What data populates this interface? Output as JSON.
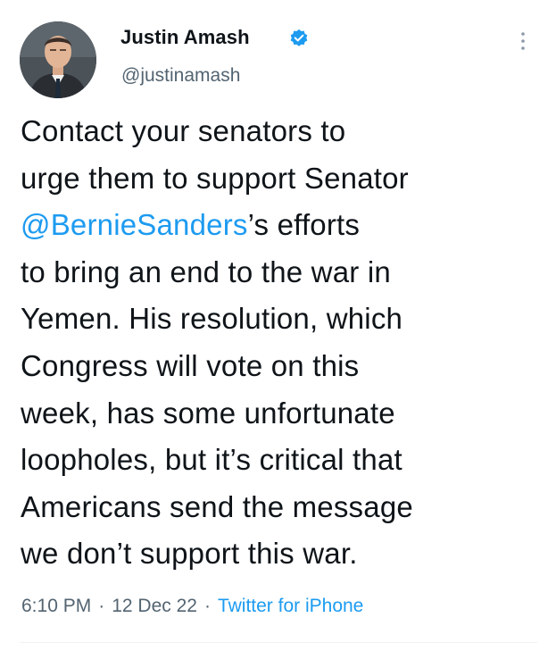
{
  "author": {
    "name": "Justin Amash",
    "handle": "@justinamash",
    "avatar": "profile-photo",
    "verified_icon": "verified-badge-icon",
    "verified_color": "#1d9bf0"
  },
  "tweet": {
    "lines": [
      "Contact your senators to",
      "urge them to support Senator",
      {
        "mention": "@BernieSanders",
        "after": "’s efforts"
      },
      "to bring an end to the war in",
      "Yemen. His resolution, which",
      "Congress will vote on this",
      "week, has some unfortunate",
      "loopholes, but it’s critical that",
      "Americans send the message",
      "we don’t support this war."
    ]
  },
  "meta": {
    "time": "6:10 PM",
    "separator": "·",
    "date": "12 Dec 22",
    "source": "Twitter for iPhone"
  },
  "menu_icon": "more-options-icon",
  "colors": {
    "text": "#0f1419",
    "secondary": "#536471",
    "link": "#1d9bf0"
  }
}
